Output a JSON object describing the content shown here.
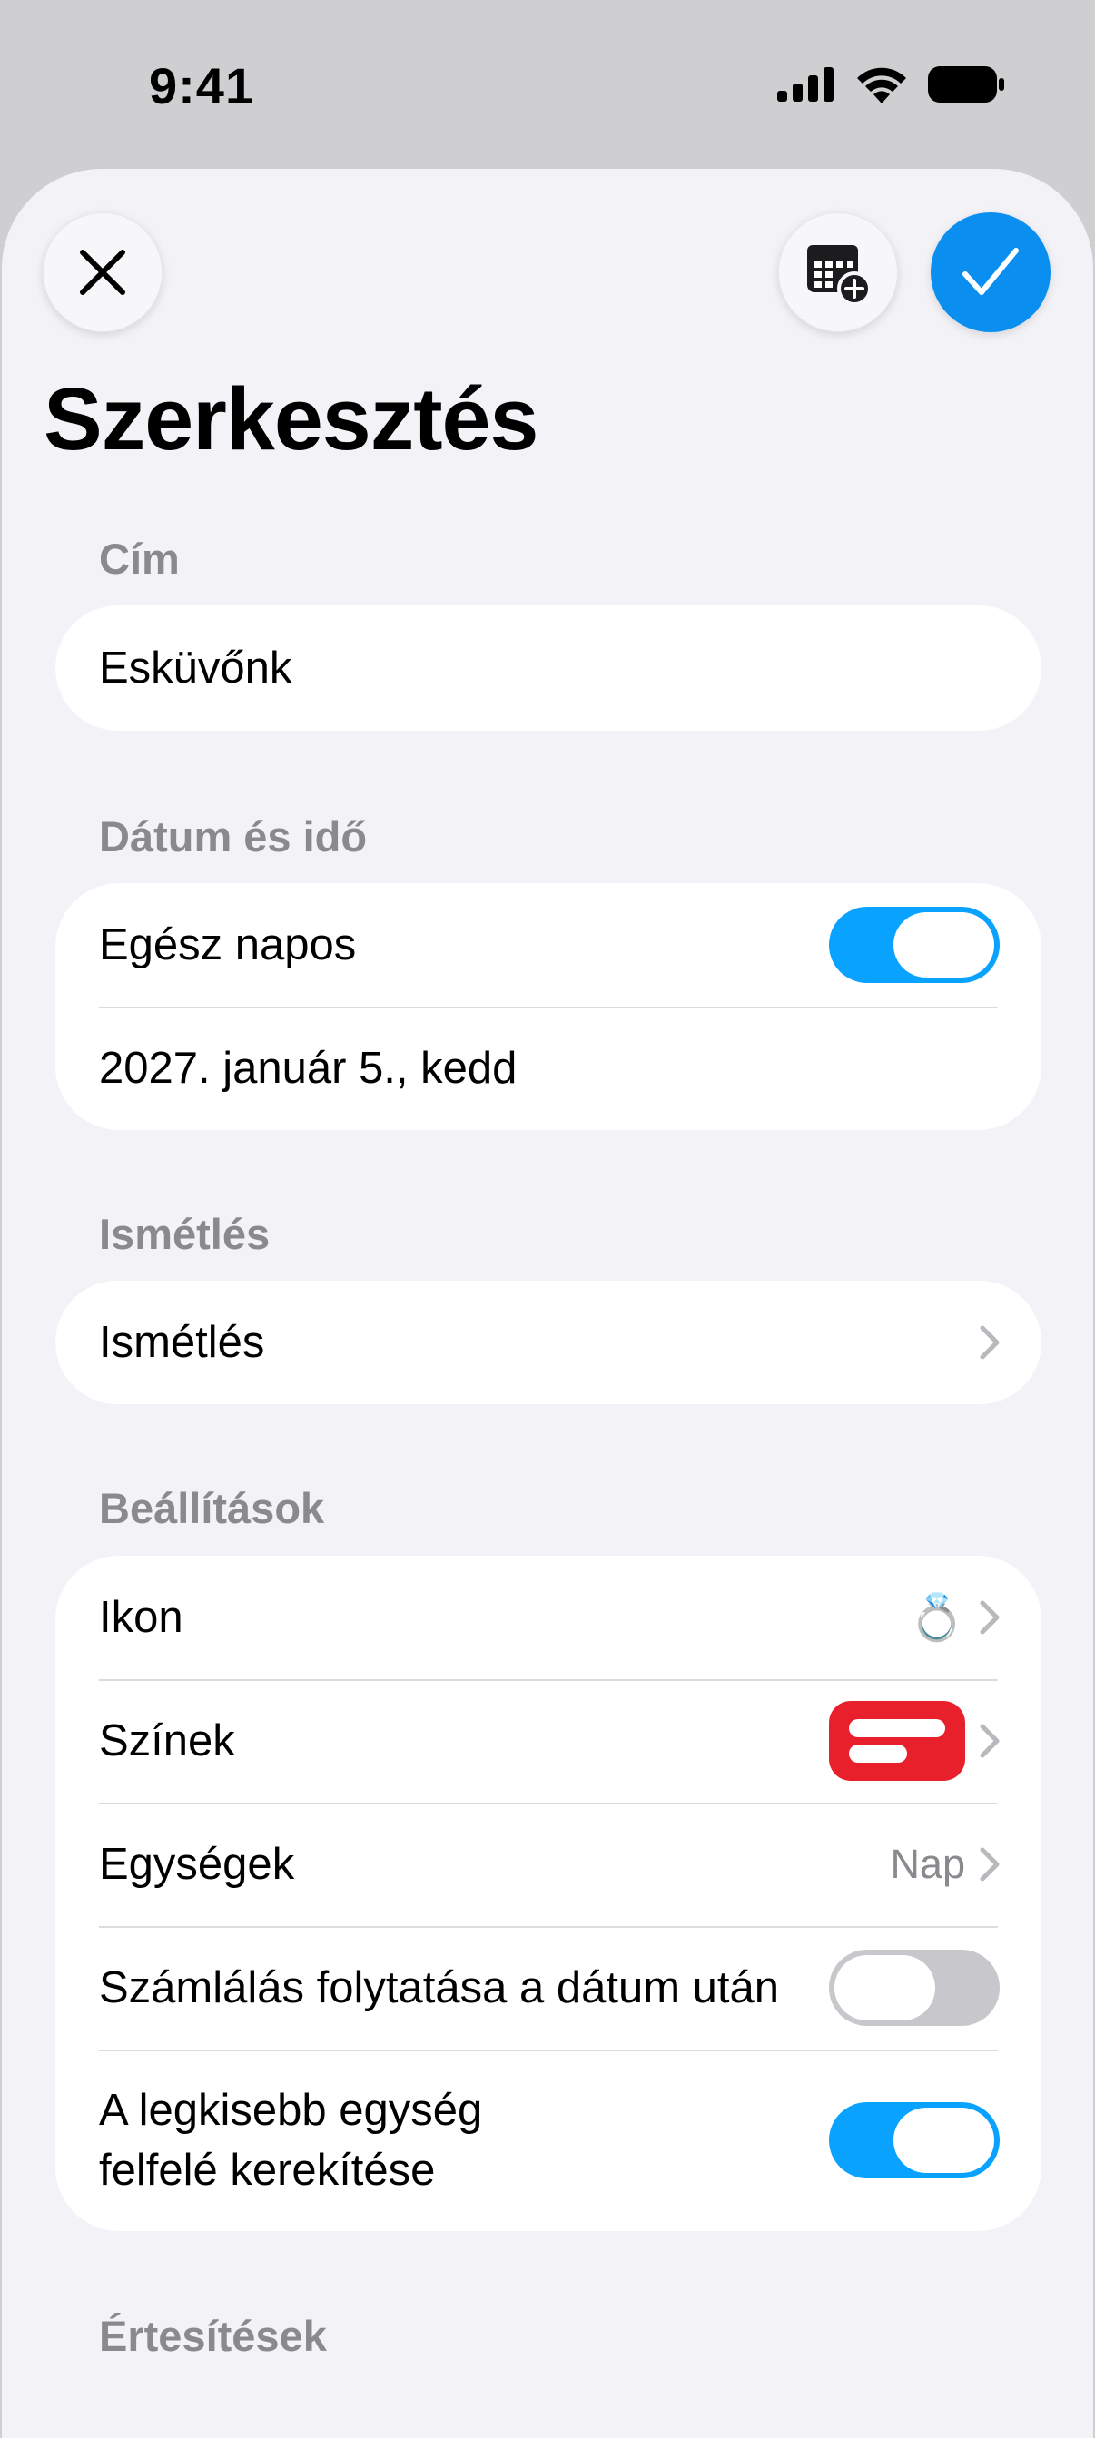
{
  "status_bar": {
    "time": "9:41",
    "icons": [
      "cellular-signal-icon",
      "wifi-icon",
      "battery-icon"
    ]
  },
  "header": {
    "close_icon": "close-icon",
    "calendar_icon": "calendar-add-icon",
    "confirm_icon": "checkmark-icon",
    "title": "Szerkesztés"
  },
  "sections": {
    "title_header": "Cím",
    "title_value": "Esküvőnk",
    "datetime_header": "Dátum és idő",
    "all_day_label": "Egész napos",
    "all_day_on": true,
    "date_value": "2027. január 5., kedd",
    "repeat_header": "Ismétlés",
    "repeat_label": "Ismétlés",
    "settings_header": "Beállítások",
    "icon_label": "Ikon",
    "icon_value": "💍",
    "colors_label": "Színek",
    "color_value": "#e8202c",
    "units_label": "Egységek",
    "units_value": "Nap",
    "count_after_label": "Számlálás folytatása a dátum után",
    "count_after_on": false,
    "round_up_label_line1": "A legkisebb egység",
    "round_up_label_line2": "felfelé kerekítése",
    "round_up_on": true,
    "notifications_header": "Értesítések"
  },
  "colors": {
    "accent": "#0a8ff0",
    "toggle_on": "#0aa2ff",
    "background": "#f2f2f7"
  }
}
